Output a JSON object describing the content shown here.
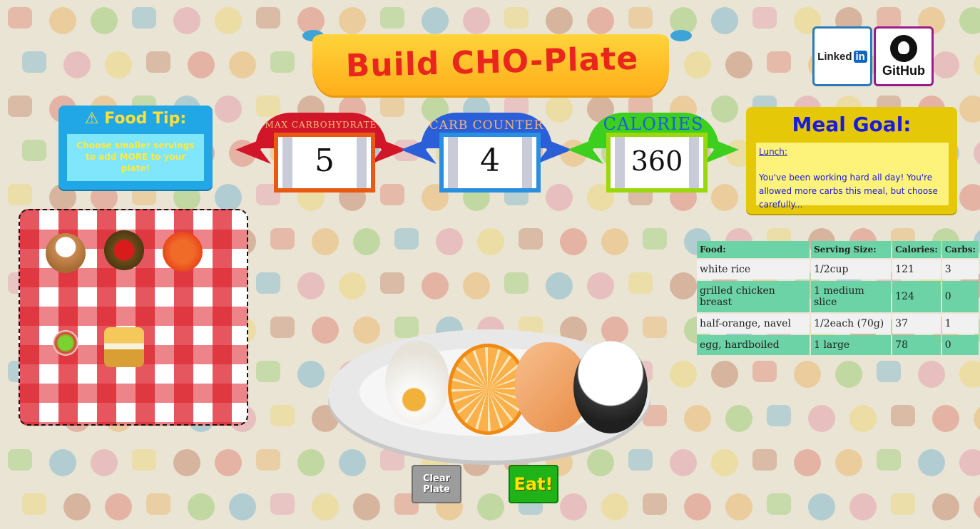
{
  "banner": {
    "title": "Build CHO-Plate"
  },
  "social": {
    "linkedin_label": "Linked",
    "linkedin_in": "in",
    "github_label": "GitHub"
  },
  "tip": {
    "title": "Food Tip:",
    "text": "Choose smaller servings to add MORE to your plate!"
  },
  "counters": [
    {
      "label": "MAX CARBOHYDRATE",
      "value": "5",
      "color": "#e8261c",
      "border": "#e85a12"
    },
    {
      "label": "CARB COUNTER",
      "value": "4",
      "color": "#2a5fd8",
      "border": "#2a8fe0"
    },
    {
      "label": "CALORIES",
      "value": "360",
      "color": "#3ccf1e",
      "border": "#9ad80d"
    }
  ],
  "goal": {
    "title": "Meal Goal:",
    "meal": "Lunch:",
    "text": "You've been working hard all day! You're allowed more carbs this meal, but choose carefully..."
  },
  "table": {
    "headers": [
      "Food:",
      "Serving Size:",
      "Calories:",
      "Carbs:"
    ],
    "rows": [
      [
        "white rice",
        "1/2cup",
        "121",
        "3"
      ],
      [
        "grilled chicken breast",
        "1 medium slice",
        "124",
        "0"
      ],
      [
        "half-orange, navel",
        "1/2each (70g)",
        "37",
        "1"
      ],
      [
        "egg, hardboiled",
        "1 large",
        "78",
        "0"
      ]
    ]
  },
  "cloth_items": [
    "baked-potato-icon",
    "spaghetti-meatballs-icon",
    "pasta-icon",
    "salad-icon",
    "sandwich-icon"
  ],
  "plate_items": [
    "egg-icon",
    "orange-icon",
    "chicken-icon",
    "rice-icon"
  ],
  "buttons": {
    "clear": "Clear Plate",
    "eat": "Eat!"
  }
}
